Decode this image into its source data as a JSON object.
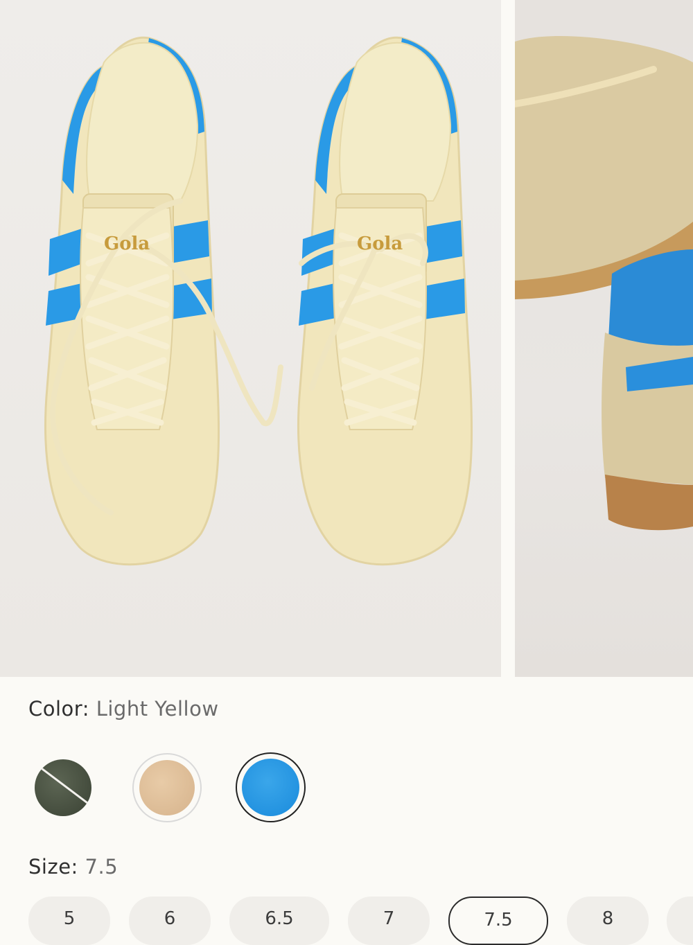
{
  "product": {
    "color_label": "Color:",
    "color_value": "Light Yellow",
    "size_label": "Size:",
    "size_value": "7.5"
  },
  "swatches": [
    {
      "name": "olive",
      "color": "#4a5342",
      "available": false
    },
    {
      "name": "sand",
      "color": "#dcbc95",
      "available": true
    },
    {
      "name": "blue",
      "color": "#1e90df",
      "available": true,
      "selected": true
    }
  ],
  "sizes": [
    "5",
    "6",
    "6.5",
    "7",
    "7.5",
    "8"
  ],
  "selected_size": "7.5"
}
